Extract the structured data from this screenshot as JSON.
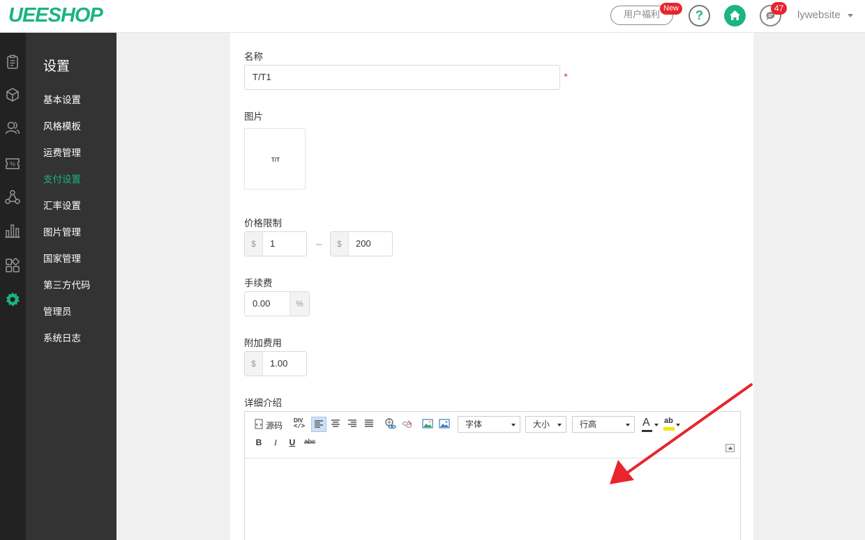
{
  "header": {
    "logo": "UEESHOP",
    "welfare_label": "用户福利",
    "new_badge": "New",
    "help_label": "?",
    "message_count": "47",
    "username": "lywebsite"
  },
  "rail": {
    "icons": [
      "orders-icon",
      "products-icon",
      "users-icon",
      "discount-icon",
      "distribution-icon",
      "stats-icon",
      "apps-icon",
      "settings-icon"
    ]
  },
  "sidebar": {
    "title": "设置",
    "items": [
      {
        "label": "基本设置",
        "active": false
      },
      {
        "label": "风格模板",
        "active": false
      },
      {
        "label": "运费管理",
        "active": false
      },
      {
        "label": "支付设置",
        "active": true
      },
      {
        "label": "汇率设置",
        "active": false
      },
      {
        "label": "图片管理",
        "active": false
      },
      {
        "label": "国家管理",
        "active": false
      },
      {
        "label": "第三方代码",
        "active": false
      },
      {
        "label": "管理员",
        "active": false
      },
      {
        "label": "系统日志",
        "active": false
      }
    ]
  },
  "form": {
    "name_label": "名称",
    "name_value": "T/T1",
    "required_mark": "*",
    "image_label": "图片",
    "image_text": "T/T",
    "price_limit_label": "价格限制",
    "currency_symbol": "$",
    "price_min": "1",
    "range_separator": "~",
    "price_max": "200",
    "fee_label": "手续费",
    "fee_value": "0.00",
    "percent_symbol": "%",
    "extra_fee_label": "附加费用",
    "extra_fee_value": "1.00",
    "detail_label": "详细介绍"
  },
  "editor": {
    "source_label": "源码",
    "div_label": "DIV",
    "font_select": "字体",
    "size_select": "大小",
    "line_height_select": "行高",
    "bold": "B",
    "italic": "I",
    "underline": "U",
    "strike": "abc",
    "color_glyph": "A",
    "highlight_glyph": "ab"
  },
  "colors": {
    "brand": "#1bb57e",
    "badge": "#e8242c",
    "annotation_arrow": "#e8242c"
  }
}
